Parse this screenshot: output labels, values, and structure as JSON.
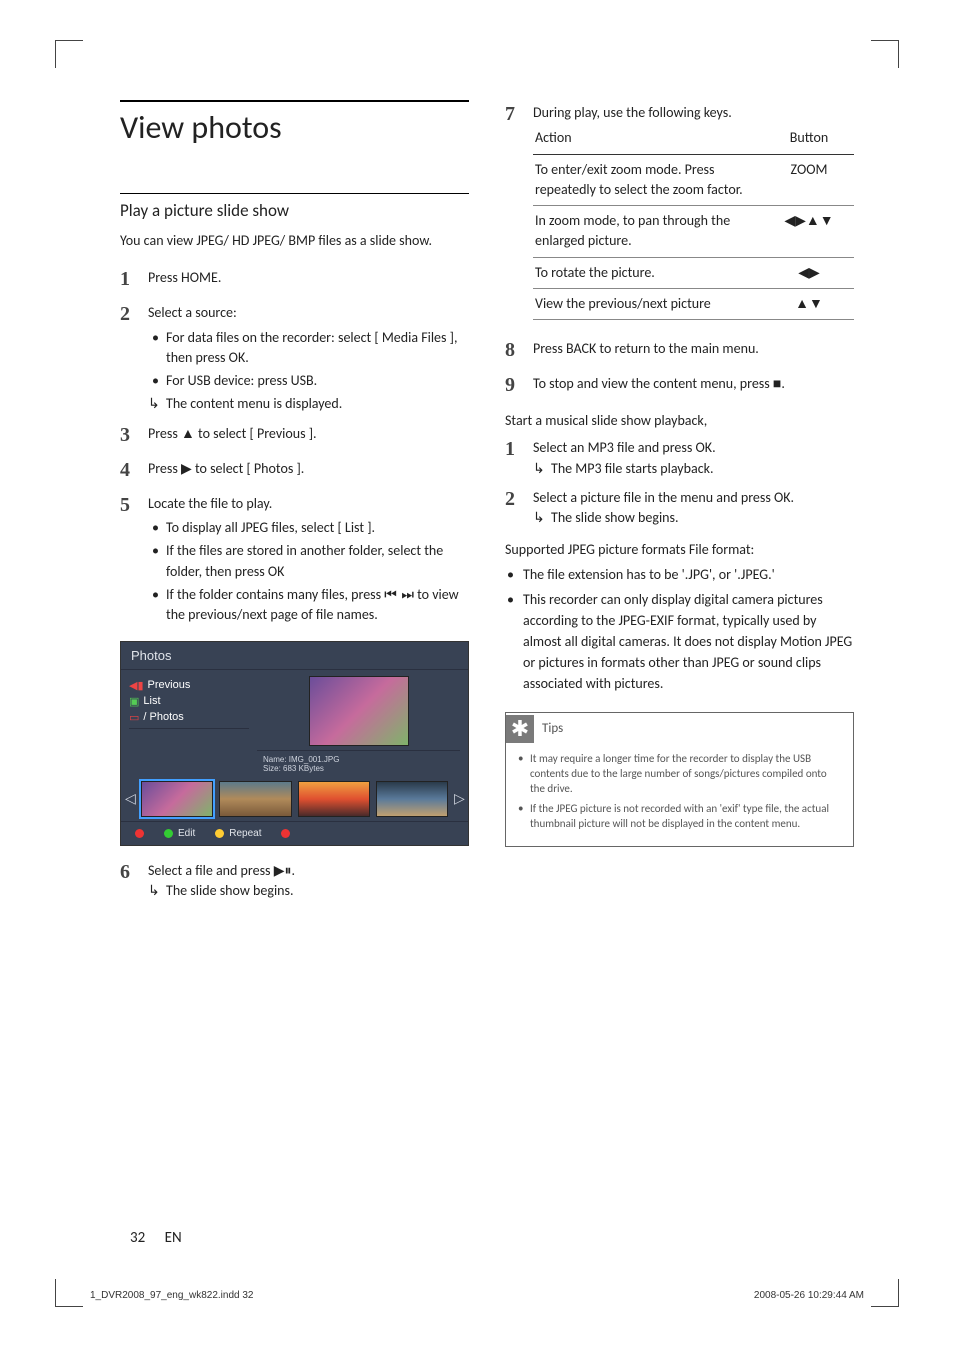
{
  "h1": "View photos",
  "left": {
    "h2": "Play a picture slide show",
    "intro": "You can view JPEG/ HD JPEG/ BMP files as a slide show.",
    "steps": [
      {
        "num": "1",
        "text_pre": "Press ",
        "bold": "HOME",
        "text_post": "."
      },
      {
        "num": "2",
        "text": "Select a source:",
        "bullets": [
          {
            "bold_pre": "For data files on the recorder:",
            "rest": " select [ Media Files ], then press ",
            "bold2": "OK",
            "rest2": "."
          },
          {
            "bold_pre": "For USB device",
            "rest": ": press ",
            "bold2": "USB",
            "rest2": "."
          }
        ],
        "arrow": "The content menu is displayed."
      },
      {
        "num": "3",
        "text_pre": "Press ",
        "glyph": "▲",
        "text_mid": " to select ",
        "bold": "[ Previous ]",
        "text_post": "."
      },
      {
        "num": "4",
        "text_pre": "Press ",
        "glyph": "▶",
        "text_mid": " to select ",
        "bold": "[ Photos ]",
        "text_post": "."
      },
      {
        "num": "5",
        "text": "Locate the file to play.",
        "bullets": [
          {
            "rest": "To display all JPEG files, select ",
            "bold2": "[ List ]",
            "rest2": "."
          },
          {
            "rest": "If the files are stored in another folder, select the folder, then press ",
            "bold2": "OK",
            "rest2": ""
          },
          {
            "rest": "If the folder contains many files, press ",
            "glyph": "⏮ ⏭",
            "rest2": " to view the previous/next page of file names."
          }
        ]
      },
      {
        "num": "6",
        "text_pre": "Select a file and press ",
        "glyph": "▶⏸",
        "text_post": ".",
        "arrow": "The slide show begins."
      }
    ]
  },
  "screenshot": {
    "title": "Photos",
    "items": [
      {
        "icon_color": "#e33",
        "glyph": "◀",
        "glyph2": "",
        "label": "Previous"
      },
      {
        "icon_color": "#3c3",
        "glyph": "📁",
        "label": "List"
      },
      {
        "icon_color": "#e33",
        "glyph": "📁",
        "label": "/ Photos"
      }
    ],
    "meta1": "Name: IMG_001.JPG",
    "meta2": "Size: 683 KBytes",
    "btn_edit": "Edit",
    "btn_repeat": "Repeat"
  },
  "right": {
    "step7_intro": "During play, use the following keys.",
    "table_head_action": "Action",
    "table_head_button": "Button",
    "rows": [
      {
        "action": "To enter/exit zoom mode. Press repeatedly to select the zoom factor.",
        "button": "ZOOM"
      },
      {
        "action": "In zoom mode, to pan through the enlarged picture.",
        "button": "◀▶▲▼"
      },
      {
        "action": "To rotate the picture.",
        "button": "◀▶"
      },
      {
        "action": "View the previous/next picture",
        "button": "▲▼"
      }
    ],
    "step8_pre": "Press ",
    "step8_bold": "BACK",
    "step8_post": " to return to the main menu.",
    "step9_pre": "To stop and view the content menu, press ",
    "step9_glyph": "■",
    "step9_post": ".",
    "music_hdr": "Start a musical slide show playback,",
    "music_steps": [
      {
        "num": "1",
        "text_pre": "Select an MP3 file and press ",
        "bold": "OK",
        "text_post": ".",
        "arrow": "The MP3 file starts playback."
      },
      {
        "num": "2",
        "text_pre": "Select a picture file in the menu and press ",
        "bold": "OK",
        "text_post": ".",
        "arrow": "The slide show begins."
      }
    ],
    "jpeg_hdr": "Supported JPEG picture formats File format:",
    "jpeg_bullets": [
      "The file extension has to be '.JPG', or '.JPEG.'",
      "This recorder can only display digital camera pictures according to the JPEG-EXIF format, typically used by almost all digital cameras.  It does not display Motion JPEG or pictures in formats other than JPEG or sound clips associated with pictures."
    ],
    "tips_label": "Tips",
    "tips": [
      "It may require a longer time for the recorder to display the USB contents due to the large number of songs/pictures compiled onto the drive.",
      "If the JPEG picture is not recorded with an 'exif' type file, the actual thumbnail picture will not be displayed in the content menu."
    ]
  },
  "footer_page": "32",
  "footer_lang": "EN",
  "print_left": "1_DVR2008_97_eng_wk822.indd   32",
  "print_right": "2008-05-26   10:29:44 AM"
}
